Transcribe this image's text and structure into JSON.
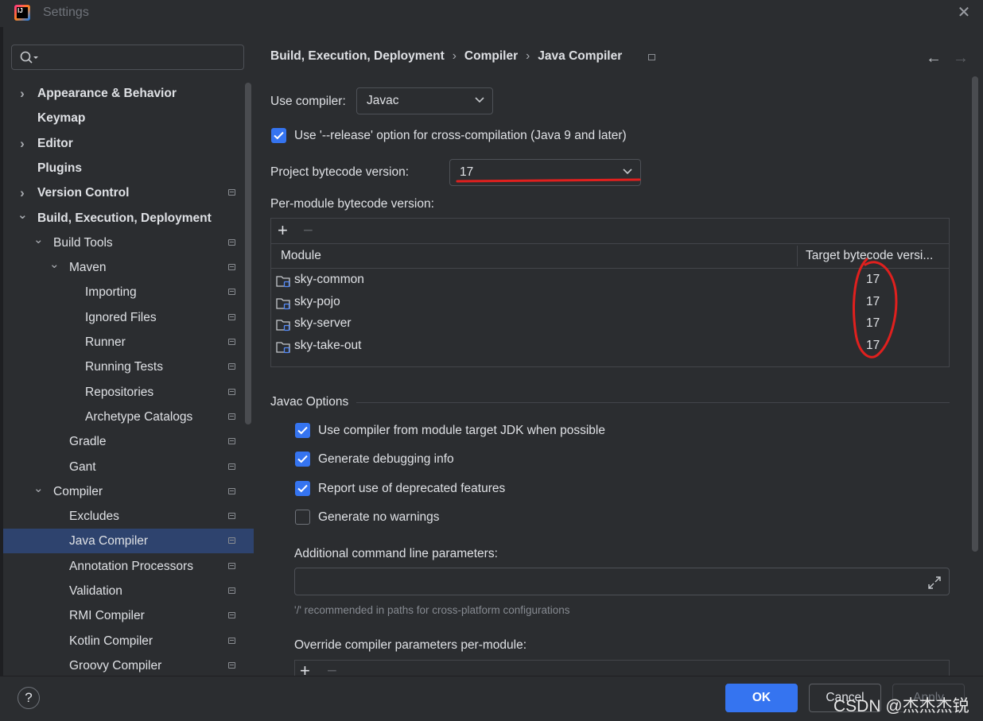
{
  "window": {
    "title": "Settings",
    "logo_text": "IJ"
  },
  "search": {
    "placeholder": "",
    "value": ""
  },
  "sidebar": {
    "items": [
      {
        "label": "Appearance & Behavior",
        "expanded": false
      },
      {
        "label": "Keymap"
      },
      {
        "label": "Editor",
        "expanded": false
      },
      {
        "label": "Plugins"
      },
      {
        "label": "Version Control",
        "expanded": false
      },
      {
        "label": "Build, Execution, Deployment",
        "expanded": true
      },
      {
        "label": "Build Tools",
        "expanded": true
      },
      {
        "label": "Maven",
        "expanded": true
      },
      {
        "label": "Importing"
      },
      {
        "label": "Ignored Files"
      },
      {
        "label": "Runner"
      },
      {
        "label": "Running Tests"
      },
      {
        "label": "Repositories"
      },
      {
        "label": "Archetype Catalogs"
      },
      {
        "label": "Gradle"
      },
      {
        "label": "Gant"
      },
      {
        "label": "Compiler",
        "expanded": true
      },
      {
        "label": "Excludes"
      },
      {
        "label": "Java Compiler",
        "selected": true
      },
      {
        "label": "Annotation Processors"
      },
      {
        "label": "Validation"
      },
      {
        "label": "RMI Compiler"
      },
      {
        "label": "Kotlin Compiler"
      },
      {
        "label": "Groovy Compiler"
      }
    ]
  },
  "breadcrumb": [
    "Build, Execution, Deployment",
    "Compiler",
    "Java Compiler"
  ],
  "compiler": {
    "use_compiler_label": "Use compiler:",
    "use_compiler_value": "Javac",
    "release_option_label": "Use '--release' option for cross-compilation (Java 9 and later)",
    "release_option_checked": true,
    "bytecode_label": "Project bytecode version:",
    "bytecode_value": "17",
    "per_module_label": "Per-module bytecode version:"
  },
  "module_table": {
    "columns": [
      "Module",
      "Target bytecode versi..."
    ],
    "rows": [
      {
        "module": "sky-common",
        "version": "17"
      },
      {
        "module": "sky-pojo",
        "version": "17"
      },
      {
        "module": "sky-server",
        "version": "17"
      },
      {
        "module": "sky-take-out",
        "version": "17"
      }
    ]
  },
  "javac_options": {
    "title": "Javac Options",
    "options": [
      {
        "label": "Use compiler from module target JDK when possible",
        "checked": true
      },
      {
        "label": "Generate debugging info",
        "checked": true
      },
      {
        "label": "Report use of deprecated features",
        "checked": true
      },
      {
        "label": "Generate no warnings",
        "checked": false
      }
    ],
    "additional_params_label": "Additional command line parameters:",
    "additional_params_value": "",
    "params_hint": "'/' recommended in paths for cross-platform configurations",
    "override_label": "Override compiler parameters per-module:"
  },
  "footer": {
    "help": "?",
    "ok": "OK",
    "cancel": "Cancel",
    "apply": "Apply"
  },
  "watermark": "CSDN @杰杰杰锐",
  "colors": {
    "accent": "#3574f0",
    "background": "#2b2d30",
    "selection": "#2e436e",
    "annotation": "#e0201e"
  }
}
